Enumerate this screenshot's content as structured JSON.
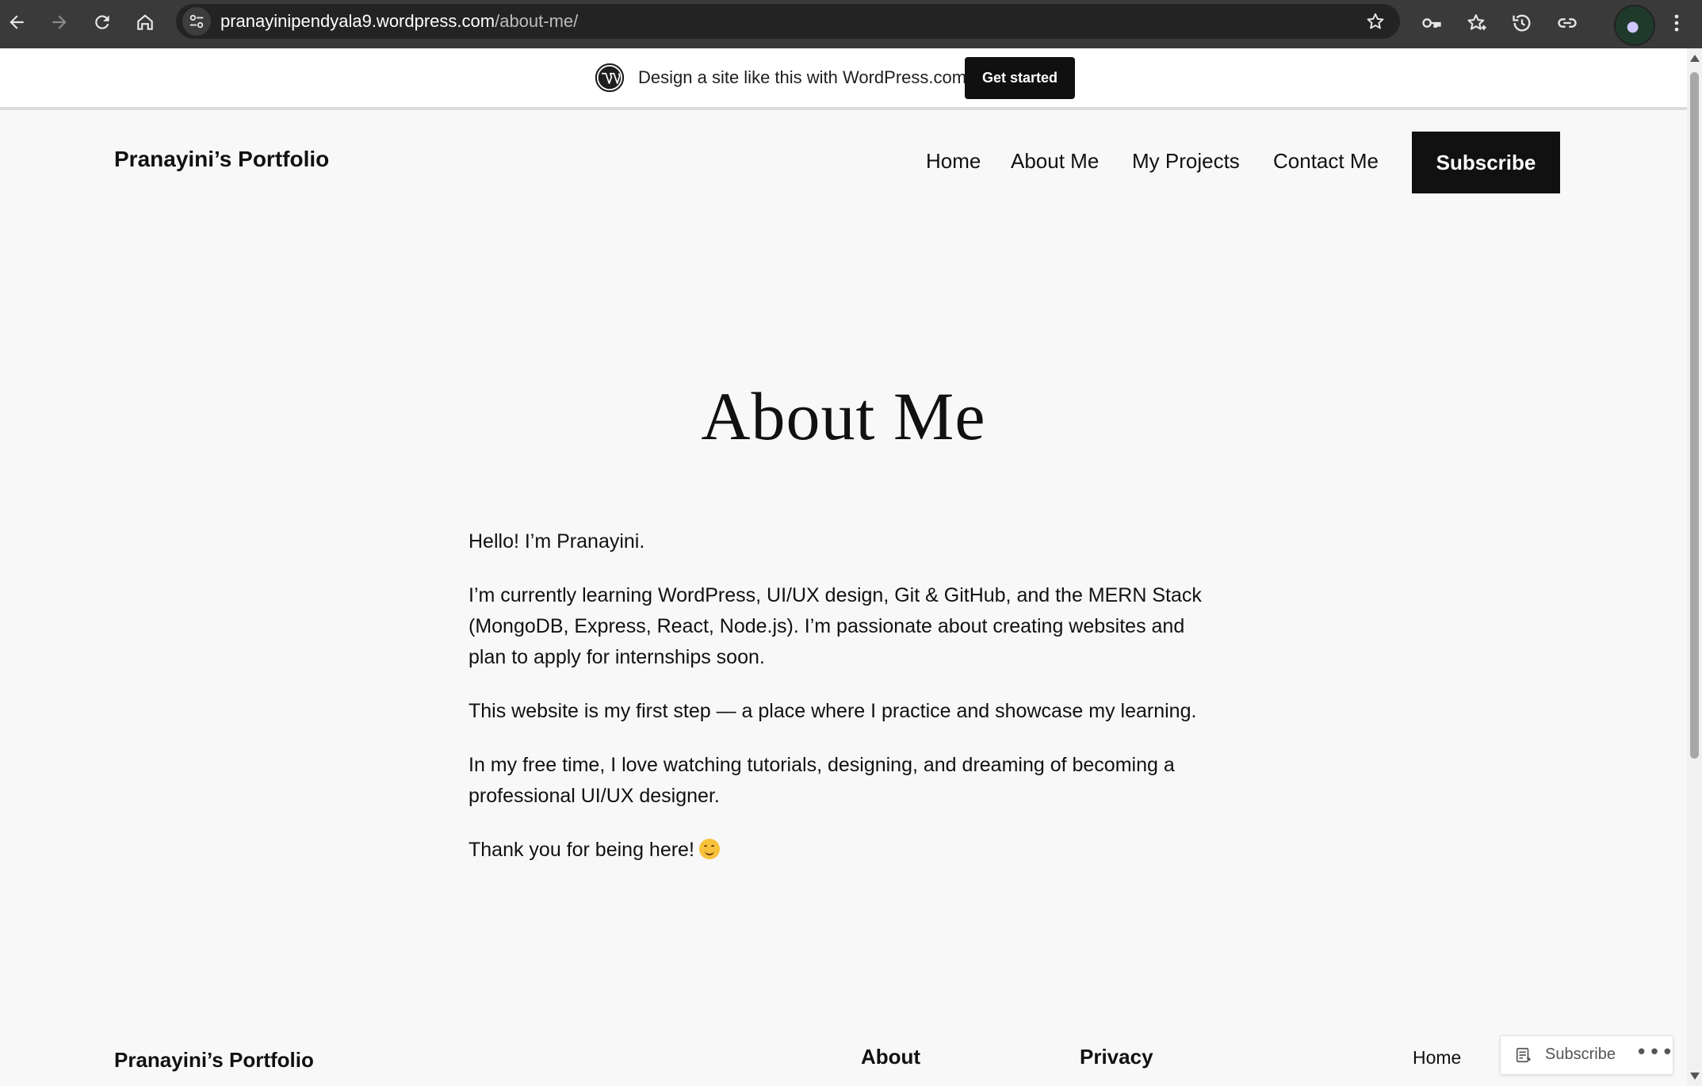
{
  "browser": {
    "url_host": "pranayinipendyala9.wordpress.com",
    "url_path": "/about-me/"
  },
  "wp_banner": {
    "text": "Design a site like this with WordPress.com",
    "button": "Get started"
  },
  "header": {
    "site_title": "Pranayini’s Portfolio",
    "nav": [
      "Home",
      "About Me",
      "My Projects",
      "Contact Me"
    ],
    "subscribe": "Subscribe"
  },
  "main": {
    "title": "About Me",
    "paragraphs": [
      "Hello! I’m Pranayini.",
      "I’m currently learning WordPress, UI/UX design, Git & GitHub, and the MERN Stack (MongoDB, Express, React, Node.js). I’m passionate about creating websites and plan to apply for internships soon.",
      "This website is my first step — a place where I practice and showcase my learning.",
      "In my free time, I love watching tutorials, designing, and dreaming of becoming a professional UI/UX designer.",
      "Thank you for being here!"
    ]
  },
  "footer": {
    "site_title": "Pranayini’s Portfolio",
    "about_heading": "About",
    "privacy_heading": "Privacy",
    "home_link": "Home"
  },
  "floating": {
    "subscribe": "Subscribe",
    "more": "•••"
  },
  "icons": {
    "back": "arrow-left-icon",
    "forward": "arrow-right-icon",
    "reload": "reload-icon",
    "home": "home-icon",
    "site_info": "tune-icon",
    "bookmark": "star-icon",
    "passwords": "key-icon",
    "favorites": "star-list-icon",
    "history": "history-icon",
    "link": "link-icon",
    "menu": "kebab-menu-icon"
  }
}
